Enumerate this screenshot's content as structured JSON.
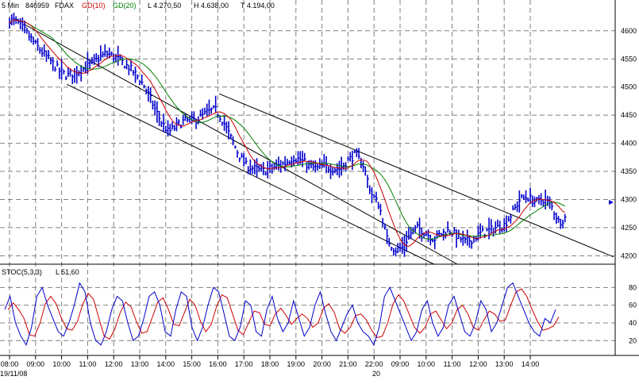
{
  "header": {
    "interval": "5 Min",
    "code": "846959",
    "symbol": "FDAX",
    "ma10_label": "GD(10)",
    "ma20_label": "GD(20)",
    "low_label": "L  4.270,50",
    "high_label": "H  4.638,00",
    "low2_label": "T  4.194,00"
  },
  "stoch_header": {
    "name": "STOC(5,3,3)",
    "value_label": "L  51,60"
  },
  "colors": {
    "candles": "#0000cc",
    "ma10": "#cc0000",
    "ma20": "#008000",
    "stoch_k": "#0000cc",
    "stoch_d": "#cc0000",
    "grid": "#808080",
    "trendline": "#000000"
  },
  "x_axis": {
    "ticks": [
      "08:00",
      "09:00",
      "10:00",
      "11:00",
      "12:00",
      "13:00",
      "14:00",
      "15:00",
      "16:00",
      "17:00",
      "18:00",
      "19:00",
      "20:00",
      "21:00",
      "22:00",
      "09:00",
      "10:00",
      "11:00",
      "12:00",
      "13:00",
      "14:00"
    ],
    "date_labels": [
      "19/11/08",
      "20"
    ]
  },
  "chart_data": [
    {
      "type": "candlestick",
      "title": "",
      "ylim": [
        4185,
        4635
      ],
      "y_ticks": [
        4200,
        4250,
        4300,
        4350,
        4400,
        4450,
        4500,
        4550,
        4600
      ],
      "last_value_marker": 4295,
      "close_path": [
        [
          0,
          4620
        ],
        [
          0.3,
          4615
        ],
        [
          0.6,
          4600
        ],
        [
          1.0,
          4575
        ],
        [
          1.3,
          4560
        ],
        [
          1.6,
          4545
        ],
        [
          1.9,
          4530
        ],
        [
          2.2,
          4520
        ],
        [
          2.5,
          4525
        ],
        [
          2.8,
          4532
        ],
        [
          3.1,
          4540
        ],
        [
          3.4,
          4550
        ],
        [
          3.7,
          4560
        ],
        [
          4.0,
          4555
        ],
        [
          4.3,
          4545
        ],
        [
          4.6,
          4535
        ],
        [
          4.9,
          4520
        ],
        [
          5.2,
          4500
        ],
        [
          5.5,
          4470
        ],
        [
          5.8,
          4440
        ],
        [
          6.1,
          4420
        ],
        [
          6.4,
          4430
        ],
        [
          6.7,
          4440
        ],
        [
          7.0,
          4440
        ],
        [
          7.3,
          4445
        ],
        [
          7.6,
          4455
        ],
        [
          7.9,
          4460
        ],
        [
          8.2,
          4440
        ],
        [
          8.5,
          4410
        ],
        [
          8.8,
          4380
        ],
        [
          9.1,
          4360
        ],
        [
          9.4,
          4355
        ],
        [
          9.7,
          4350
        ],
        [
          10.0,
          4355
        ],
        [
          10.3,
          4360
        ],
        [
          10.6,
          4365
        ],
        [
          10.9,
          4375
        ],
        [
          11.2,
          4370
        ],
        [
          11.5,
          4360
        ],
        [
          11.8,
          4355
        ],
        [
          12.1,
          4360
        ],
        [
          12.4,
          4355
        ],
        [
          12.7,
          4355
        ],
        [
          13.0,
          4370
        ],
        [
          13.3,
          4380
        ],
        [
          13.6,
          4360
        ],
        [
          13.9,
          4310
        ],
        [
          14.2,
          4290
        ],
        [
          14.5,
          4230
        ],
        [
          14.8,
          4210
        ],
        [
          15.1,
          4215
        ],
        [
          15.4,
          4240
        ],
        [
          15.7,
          4250
        ],
        [
          16.0,
          4240
        ],
        [
          16.3,
          4230
        ],
        [
          16.6,
          4240
        ],
        [
          16.9,
          4245
        ],
        [
          17.2,
          4235
        ],
        [
          17.5,
          4225
        ],
        [
          17.8,
          4230
        ],
        [
          18.1,
          4240
        ],
        [
          18.4,
          4245
        ],
        [
          18.7,
          4250
        ],
        [
          19.0,
          4255
        ],
        [
          19.3,
          4275
        ],
        [
          19.6,
          4300
        ],
        [
          19.9,
          4305
        ],
        [
          20.2,
          4295
        ],
        [
          20.5,
          4300
        ],
        [
          20.8,
          4290
        ],
        [
          21.1,
          4260
        ],
        [
          21.4,
          4270
        ]
      ],
      "ma10_label": "GD(10)",
      "ma20_label": "GD(20)",
      "low": 4270.5,
      "high": 4638.0,
      "low_day": 4194.0
    },
    {
      "type": "line",
      "title": "STOC(5,3,3)",
      "ylim": [
        5,
        100
      ],
      "y_ticks": [
        20,
        40,
        60,
        80
      ],
      "last_value": 51.6,
      "series": [
        {
          "name": "STOC(5,3,3)",
          "values": [
            55,
            70,
            40,
            25,
            15,
            35,
            70,
            80,
            60,
            45,
            30,
            25,
            40,
            60,
            85,
            75,
            40,
            20,
            15,
            30,
            55,
            70,
            65,
            40,
            20,
            25,
            45,
            70,
            75,
            60,
            30,
            25,
            55,
            75,
            70,
            35,
            20,
            35,
            60,
            80,
            75,
            50,
            25,
            20,
            35,
            65,
            60,
            30,
            25,
            55,
            70,
            45,
            30,
            40,
            65,
            45,
            25,
            35,
            60,
            75,
            50,
            30,
            20,
            35,
            50,
            60,
            40,
            30,
            25,
            15,
            35,
            70,
            80,
            65,
            50,
            35,
            20,
            30,
            55,
            65,
            40,
            25,
            35,
            60,
            70,
            50,
            30,
            25,
            40,
            65,
            55,
            30,
            40,
            60,
            80,
            85,
            70,
            55,
            40,
            30,
            25,
            45,
            40,
            55
          ]
        }
      ]
    }
  ]
}
